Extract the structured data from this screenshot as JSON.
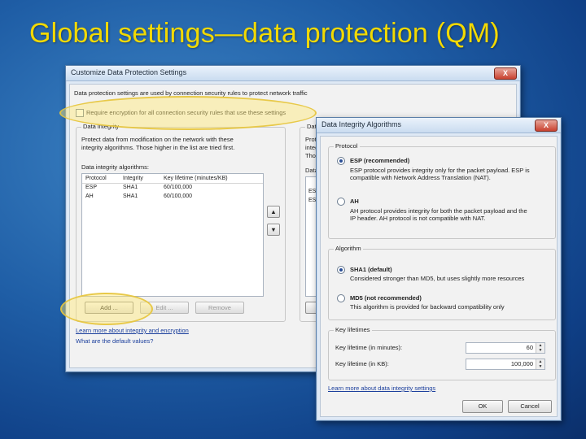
{
  "slide": {
    "title": "Global settings—data protection (QM)"
  },
  "main_dialog": {
    "title": "Customize Data Protection Settings",
    "close": "X",
    "intro": "Data protection settings are used by connection security rules to protect network traffic",
    "require_encryption": "Require encryption for all connection security rules that use these settings",
    "integrity_group": {
      "label": "Data integrity",
      "desc1": "Protect data from modification on the network with these",
      "desc2": "integrity algorithms. Those higher in the list are tried first.",
      "list_label": "Data integrity algorithms:",
      "columns": [
        "Protocol",
        "Integrity",
        "Key lifetime (minutes/KB)"
      ],
      "rows": [
        [
          "ESP",
          "SHA1",
          "60/100,000"
        ],
        [
          "AH",
          "SHA1",
          "60/100,000"
        ]
      ],
      "buttons": {
        "add": "Add ...",
        "edit": "Edit ...",
        "remove": "Remove"
      }
    },
    "right_group": {
      "label": "Data",
      "p1": "Prot",
      "p2": "integ",
      "p3": "Thos",
      "list_label": "Data",
      "rows": [
        "ESP",
        "ESP"
      ]
    },
    "link_learn": "Learn more about integrity and encryption",
    "link_defaults": "What are the default values?"
  },
  "algo_dialog": {
    "title": "Data Integrity Algorithms",
    "close": "X",
    "protocol_group": {
      "label": "Protocol",
      "esp_label": "ESP (recommended)",
      "esp_desc1": "ESP protocol provides integrity only for the packet payload. ESP is",
      "esp_desc2": "compatible with Network Address Translation (NAT).",
      "ah_label": "AH",
      "ah_desc1": "AH protocol provides integrity for both the packet payload and the",
      "ah_desc2": "IP header. AH protocol is not compatible with NAT."
    },
    "algorithm_group": {
      "label": "Algorithm",
      "sha1_label": "SHA1 (default)",
      "sha1_desc": "Considered stronger than MD5, but uses slightly more resources",
      "md5_label": "MD5 (not recommended)",
      "md5_desc": "This algorithm is provided for backward compatibility only"
    },
    "key_group": {
      "label": "Key lifetimes",
      "minutes_label": "Key lifetime (in minutes):",
      "minutes_value": "60",
      "kb_label": "Key lifetime (in KB):",
      "kb_value": "100,000"
    },
    "link_learn": "Learn more about data integrity settings",
    "ok": "OK",
    "cancel": "Cancel"
  }
}
